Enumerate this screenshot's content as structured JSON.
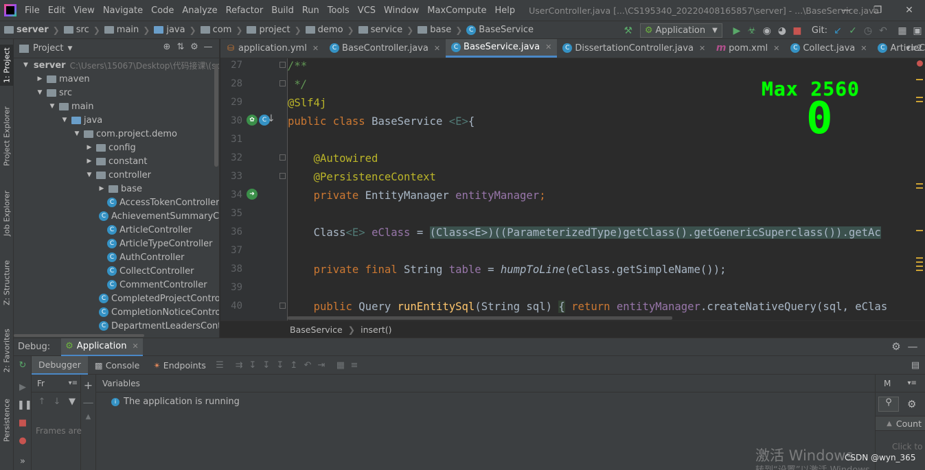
{
  "menubar": {
    "items": [
      "File",
      "Edit",
      "View",
      "Navigate",
      "Code",
      "Analyze",
      "Refactor",
      "Build",
      "Run",
      "Tools",
      "VCS",
      "Window",
      "MaxCompute",
      "Help"
    ],
    "window_title": "UserController.java [...\\CS195340_20220408165857\\server] - ...\\BaseService.java"
  },
  "navbar": {
    "crumbs": [
      "server",
      "src",
      "main",
      "java",
      "com",
      "project",
      "demo",
      "service",
      "base",
      "BaseService"
    ],
    "run_config": "Application",
    "git_label": "Git:"
  },
  "left_stripe": {
    "tabs": [
      "1: Project",
      "Project Explorer",
      "Job Explorer",
      "Z: Structure",
      "2: Favorites",
      "Persistence"
    ]
  },
  "project_panel": {
    "title": "Project",
    "tree": [
      {
        "label": "server",
        "hint": "C:\\Users\\15067\\Desktop\\代码接课\\(sp",
        "arrow": "▼",
        "icon": "folder",
        "indent": 0
      },
      {
        "label": "maven",
        "arrow": "▶",
        "icon": "folder",
        "indent": 1
      },
      {
        "label": "src",
        "arrow": "▼",
        "icon": "folder",
        "indent": 1
      },
      {
        "label": "main",
        "arrow": "▼",
        "icon": "folder",
        "indent": 2
      },
      {
        "label": "java",
        "arrow": "▼",
        "icon": "folder-blue",
        "indent": 3
      },
      {
        "label": "com.project.demo",
        "arrow": "▼",
        "icon": "folder",
        "indent": 4
      },
      {
        "label": "config",
        "arrow": "▶",
        "icon": "folder",
        "indent": 5
      },
      {
        "label": "constant",
        "arrow": "▶",
        "icon": "folder",
        "indent": 5
      },
      {
        "label": "controller",
        "arrow": "▼",
        "icon": "folder",
        "indent": 5
      },
      {
        "label": "base",
        "arrow": "▶",
        "icon": "folder",
        "indent": 6
      },
      {
        "label": "AccessTokenController",
        "arrow": "",
        "icon": "class",
        "indent": 6
      },
      {
        "label": "AchievementSummaryCont",
        "arrow": "",
        "icon": "class",
        "indent": 6
      },
      {
        "label": "ArticleController",
        "arrow": "",
        "icon": "class",
        "indent": 6
      },
      {
        "label": "ArticleTypeController",
        "arrow": "",
        "icon": "class",
        "indent": 6
      },
      {
        "label": "AuthController",
        "arrow": "",
        "icon": "class",
        "indent": 6
      },
      {
        "label": "CollectController",
        "arrow": "",
        "icon": "class",
        "indent": 6
      },
      {
        "label": "CommentController",
        "arrow": "",
        "icon": "class",
        "indent": 6
      },
      {
        "label": "CompletedProjectControlle",
        "arrow": "",
        "icon": "class",
        "indent": 6
      },
      {
        "label": "CompletionNoticeControlle",
        "arrow": "",
        "icon": "class",
        "indent": 6
      },
      {
        "label": "DepartmentLeadersContro",
        "arrow": "",
        "icon": "class",
        "indent": 6
      }
    ]
  },
  "editor_tabs": [
    {
      "label": "application.yml",
      "icon": "yml",
      "active": false
    },
    {
      "label": "BaseController.java",
      "icon": "class",
      "active": false
    },
    {
      "label": "BaseService.java",
      "icon": "class",
      "active": true
    },
    {
      "label": "DissertationController.java",
      "icon": "class",
      "active": false
    },
    {
      "label": "pom.xml",
      "icon": "maven",
      "active": false
    },
    {
      "label": "Collect.java",
      "icon": "class",
      "active": false
    },
    {
      "label": "ArticleControl",
      "icon": "class",
      "active": false
    }
  ],
  "editor": {
    "line_numbers": [
      "27",
      "28",
      "29",
      "30",
      "31",
      "32",
      "33",
      "34",
      "35",
      "36",
      "37",
      "38",
      "39",
      "40"
    ],
    "code": {
      "l27": "/**",
      "l28": " */",
      "l29": "@Slf4j",
      "l30_kw": "public class",
      "l30_name": "BaseService",
      "l30_gen": "<E>",
      "l30_end": "{",
      "l32": "@Autowired",
      "l33": "@PersistenceContext",
      "l34_kw": "private",
      "l34_type": "EntityManager",
      "l34_field": "entityManager",
      "l34_end": ";",
      "l36_a": "Class",
      "l36_b": "<E>",
      "l36_c": "eClass",
      "l36_d": "=",
      "l36_e": "(Class<E>)((ParameterizedType)getClass().getGenericSuperclass()).getAc",
      "l38_kw": "private final",
      "l38_type": "String",
      "l38_field": "table",
      "l38_eq": "=",
      "l38_call": "humpToLine",
      "l38_rest": "(eClass.getSimpleName());",
      "l40_kw": "public",
      "l40_type": "Query",
      "l40_method": "runEntitySql",
      "l40_params": "(String sql)",
      "l40_brace": "{",
      "l40_ret": "return",
      "l40_field": "entityManager",
      "l40_rest": ".createNativeQuery(sql, eClas"
    },
    "overlay_max": "Max 2560",
    "overlay_value": "0",
    "breadcrumb": [
      "BaseService",
      "insert()"
    ]
  },
  "debug": {
    "label": "Debug:",
    "tab": "Application",
    "subtabs": [
      "Debugger",
      "Console",
      "Endpoints"
    ],
    "frames_header": "Fr",
    "frames_empty": "Frames are",
    "variables_header": "Variables",
    "message": "The application is running",
    "memory_header": "M",
    "count_label": "Count",
    "memory_hint": "Click to load"
  },
  "watermark": {
    "line1": "激活 Windows",
    "line2": "转到“设置”以激活 Windows。",
    "csdn": "CSDN @wyn_365"
  },
  "colors": {
    "background": "#2b2b2b",
    "panel": "#3c3f41",
    "keyword": "#cc7832",
    "annotation": "#bbb529",
    "overlay": "#00ff00"
  }
}
